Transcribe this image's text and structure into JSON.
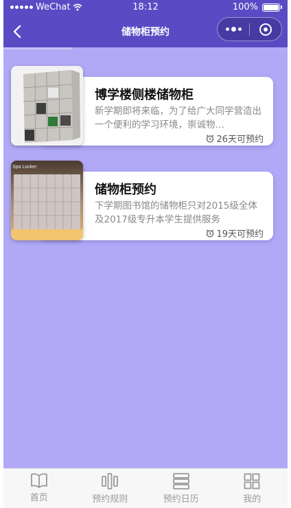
{
  "status_bar": {
    "carrier": "WeChat",
    "time": "18:12",
    "battery": "100%"
  },
  "nav": {
    "title": "储物柜预约"
  },
  "cards": [
    {
      "title": "博学楼侧楼储物柜",
      "desc": "新学期即将来临，为了给广大同学营造出一个便利的学习环境，崇诚物…",
      "days": "26天可预约",
      "image": "locker-cabinet-photo"
    },
    {
      "title": "储物柜预约",
      "desc": "下学期图书馆的储物柜只对2015级全体及2017级专升本学生提供服务",
      "days": "19天可预约",
      "image": "spa-locker-photo",
      "image_caption": "Spa Locker"
    }
  ],
  "tabs": [
    {
      "label": "首页",
      "icon": "book-icon"
    },
    {
      "label": "预约规则",
      "icon": "bars-icon"
    },
    {
      "label": "预约日历",
      "icon": "stack-icon"
    },
    {
      "label": "我的",
      "icon": "grid-icon"
    }
  ],
  "colors": {
    "header": "#5a4bc4",
    "background": "#b1a9f5",
    "tab_text": "#999999"
  }
}
